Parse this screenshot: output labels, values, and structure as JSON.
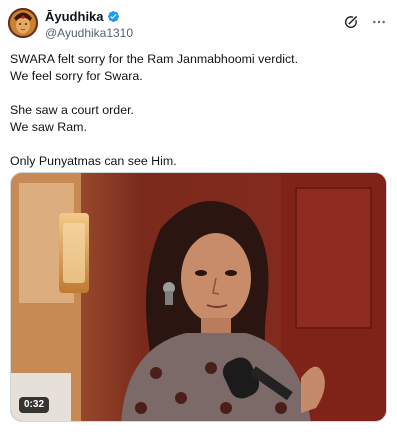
{
  "author": {
    "display_name": "Āyudhika",
    "handle": "@Ayudhika1310",
    "verified": true
  },
  "tweet": {
    "lines": [
      "SWARA felt sorry for the Ram Janmabhoomi verdict.",
      "We feel sorry for Swara.",
      "",
      "She saw a court order.",
      "We saw Ram.",
      "",
      "Only Punyatmas can see Him."
    ]
  },
  "media": {
    "type": "video",
    "duration": "0:32"
  },
  "icons": {
    "verified": "verified-badge-icon",
    "grok": "grok-icon",
    "more": "more-options-icon"
  },
  "colors": {
    "text": "#0f1419",
    "secondary": "#536471",
    "verified": "#1d9bf0"
  }
}
